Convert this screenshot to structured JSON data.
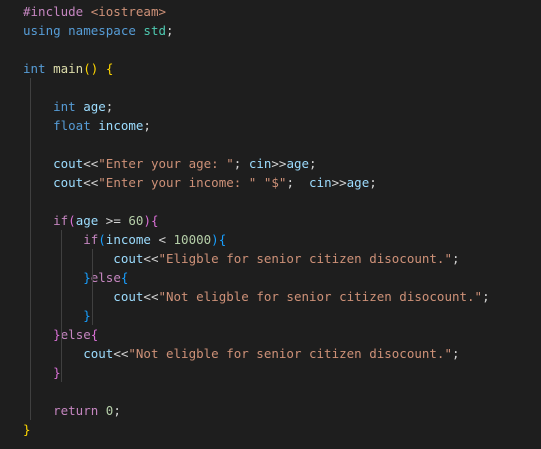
{
  "code": {
    "language": "cpp",
    "lines": [
      [
        {
          "t": "#include ",
          "c": "pre"
        },
        {
          "t": "<iostream>",
          "c": "inc"
        }
      ],
      [
        {
          "t": "using ",
          "c": "kw"
        },
        {
          "t": "namespace ",
          "c": "kw"
        },
        {
          "t": "std",
          "c": "ns"
        },
        {
          "t": ";",
          "c": "op"
        }
      ],
      [],
      [
        {
          "t": "int ",
          "c": "kw"
        },
        {
          "t": "main",
          "c": "fn"
        },
        {
          "t": "()",
          "c": "b1"
        },
        {
          "t": " ",
          "c": "op"
        },
        {
          "t": "{",
          "c": "b1"
        }
      ],
      [],
      [
        {
          "t": "    int ",
          "c": "kw"
        },
        {
          "t": "age",
          "c": "var"
        },
        {
          "t": ";",
          "c": "op"
        }
      ],
      [
        {
          "t": "    float ",
          "c": "kw"
        },
        {
          "t": "income",
          "c": "var"
        },
        {
          "t": ";",
          "c": "op"
        }
      ],
      [],
      [
        {
          "t": "    cout",
          "c": "var"
        },
        {
          "t": "<<",
          "c": "op"
        },
        {
          "t": "\"Enter your age: \"",
          "c": "str"
        },
        {
          "t": "; ",
          "c": "op"
        },
        {
          "t": "cin",
          "c": "var"
        },
        {
          "t": ">>",
          "c": "op"
        },
        {
          "t": "age",
          "c": "var"
        },
        {
          "t": ";",
          "c": "op"
        }
      ],
      [
        {
          "t": "    cout",
          "c": "var"
        },
        {
          "t": "<<",
          "c": "op"
        },
        {
          "t": "\"Enter your income: \"",
          "c": "str"
        },
        {
          "t": " ",
          "c": "op"
        },
        {
          "t": "\"$\"",
          "c": "str"
        },
        {
          "t": ";  ",
          "c": "op"
        },
        {
          "t": "cin",
          "c": "var"
        },
        {
          "t": ">>",
          "c": "op"
        },
        {
          "t": "age",
          "c": "var"
        },
        {
          "t": ";",
          "c": "op"
        }
      ],
      [],
      [
        {
          "t": "    if",
          "c": "ctl"
        },
        {
          "t": "(",
          "c": "b2"
        },
        {
          "t": "age",
          "c": "var"
        },
        {
          "t": " >= ",
          "c": "op"
        },
        {
          "t": "60",
          "c": "num"
        },
        {
          "t": ")",
          "c": "b2"
        },
        {
          "t": "{",
          "c": "b2"
        }
      ],
      [
        {
          "t": "        if",
          "c": "ctl"
        },
        {
          "t": "(",
          "c": "b3"
        },
        {
          "t": "income",
          "c": "var"
        },
        {
          "t": " < ",
          "c": "op"
        },
        {
          "t": "10000",
          "c": "num"
        },
        {
          "t": ")",
          "c": "b3"
        },
        {
          "t": "{",
          "c": "b3"
        }
      ],
      [
        {
          "t": "            cout",
          "c": "var"
        },
        {
          "t": "<<",
          "c": "op"
        },
        {
          "t": "\"Eligble for senior citizen disocount.\"",
          "c": "str"
        },
        {
          "t": ";",
          "c": "op"
        }
      ],
      [
        {
          "t": "        ",
          "c": "op"
        },
        {
          "t": "}",
          "c": "b3"
        },
        {
          "t": "else",
          "c": "ctl"
        },
        {
          "t": "{",
          "c": "b3"
        }
      ],
      [
        {
          "t": "            cout",
          "c": "var"
        },
        {
          "t": "<<",
          "c": "op"
        },
        {
          "t": "\"Not eligble for senior citizen disocount.\"",
          "c": "str"
        },
        {
          "t": ";",
          "c": "op"
        }
      ],
      [
        {
          "t": "        ",
          "c": "op"
        },
        {
          "t": "}",
          "c": "b3"
        }
      ],
      [
        {
          "t": "    ",
          "c": "op"
        },
        {
          "t": "}",
          "c": "b2"
        },
        {
          "t": "else",
          "c": "ctl"
        },
        {
          "t": "{",
          "c": "b2"
        }
      ],
      [
        {
          "t": "        cout",
          "c": "var"
        },
        {
          "t": "<<",
          "c": "op"
        },
        {
          "t": "\"Not eligble for senior citizen disocount.\"",
          "c": "str"
        },
        {
          "t": ";",
          "c": "op"
        }
      ],
      [
        {
          "t": "    ",
          "c": "op"
        },
        {
          "t": "}",
          "c": "b2"
        }
      ],
      [],
      [
        {
          "t": "    return ",
          "c": "ctl"
        },
        {
          "t": "0",
          "c": "num"
        },
        {
          "t": ";",
          "c": "op"
        }
      ],
      [
        {
          "t": "}",
          "c": "b1"
        }
      ]
    ]
  },
  "colors": {
    "background": "#1e1e1e",
    "keyword": "#569cd6",
    "control": "#c586c0",
    "string": "#ce9178",
    "number": "#b5cea8",
    "variable": "#9cdcfe",
    "function": "#dcdcaa",
    "namespace": "#4ec9b0",
    "bracket_level1": "#ffd700",
    "bracket_level2": "#da70d6",
    "bracket_level3": "#179fff"
  }
}
